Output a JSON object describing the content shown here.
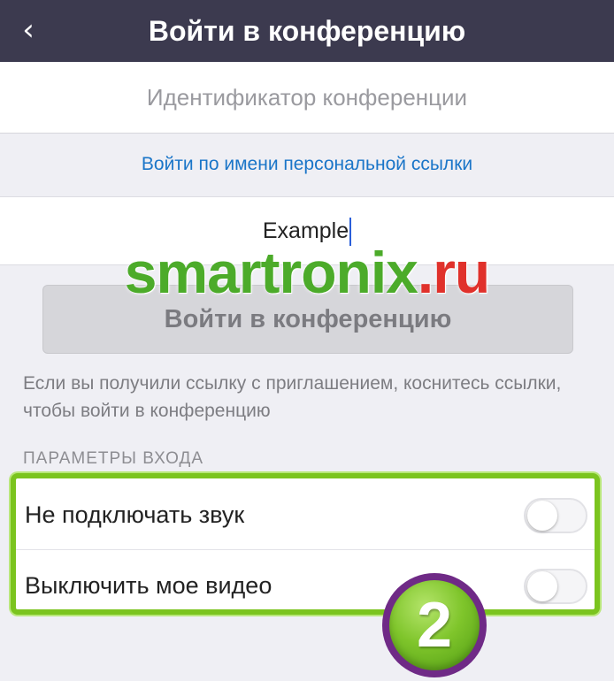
{
  "header": {
    "back_glyph": "‹",
    "title": "Войти в конференцию"
  },
  "form": {
    "meeting_id_placeholder": "Идентификатор конференции",
    "personal_link_label": "Войти по имени персональной ссылки",
    "name_value": "Example",
    "join_button_label": "Войти в конференцию",
    "hint_text": "Если вы получили ссылку с приглашением, коснитесь ссылки, чтобы войти в конференцию"
  },
  "options": {
    "section_title": "ПАРАМЕТРЫ ВХОДА",
    "items": [
      {
        "label": "Не подключать звук",
        "enabled": false
      },
      {
        "label": "Выключить мое видео",
        "enabled": false
      }
    ]
  },
  "watermark": {
    "part1": "smartronix",
    "part2": ".ru"
  },
  "step_badge": {
    "number": "2"
  },
  "colors": {
    "header_bg": "#3c3a4f",
    "link": "#1a75c8",
    "highlight": "#7bc41f",
    "badge_ring": "#6f2a86"
  },
  "icons": {
    "back": "chevron-left-icon"
  }
}
